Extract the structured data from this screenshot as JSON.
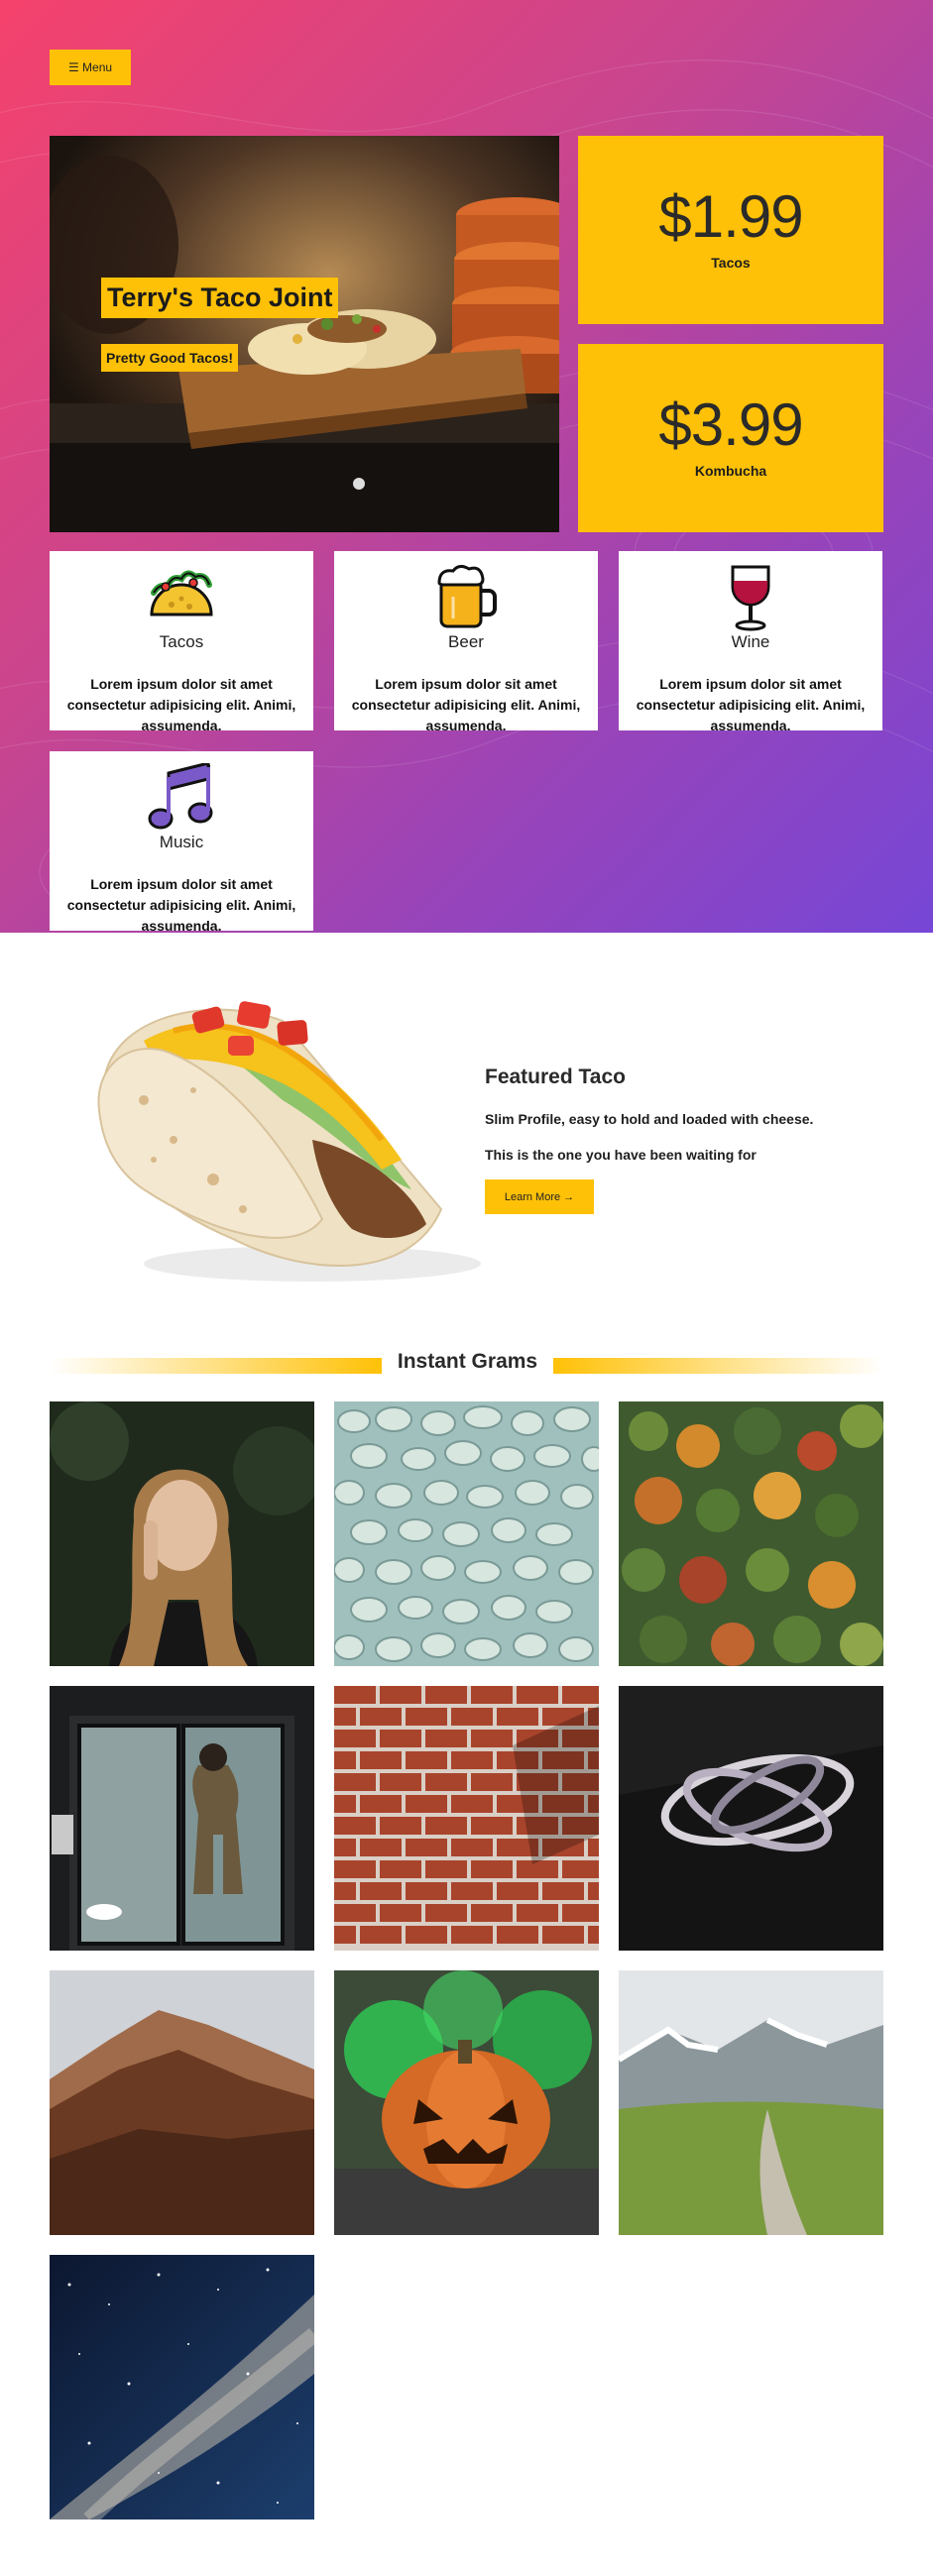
{
  "nav": {
    "menu_icon": "hamburger-icon",
    "menu_label": "☰ Menu"
  },
  "hero": {
    "title": "Terry's Taco Joint",
    "subtitle": "Pretty Good Tacos!",
    "prices": [
      {
        "amount": "$1.99",
        "name": "Tacos"
      },
      {
        "amount": "$3.99",
        "name": "Kombucha"
      }
    ],
    "colors": {
      "accent": "#ffc107",
      "gradient_start": "#f5426c",
      "gradient_end": "#7646d6"
    }
  },
  "services": [
    {
      "title": "Tacos",
      "icon": "taco-icon",
      "description": "Lorem ipsum dolor sit amet consectetur adipisicing elit. Animi, assumenda."
    },
    {
      "title": "Beer",
      "icon": "beer-mug-icon",
      "description": "Lorem ipsum dolor sit amet consectetur adipisicing elit. Animi, assumenda."
    },
    {
      "title": "Wine",
      "icon": "wine-glass-icon",
      "description": "Lorem ipsum dolor sit amet consectetur adipisicing elit. Animi, assumenda."
    },
    {
      "title": "Music",
      "icon": "music-note-icon",
      "description": "Lorem ipsum dolor sit amet consectetur adipisicing elit. Animi, assumenda."
    }
  ],
  "featured": {
    "title": "Featured Taco",
    "line1": "Slim Profile, easy to hold and loaded with cheese.",
    "line2": "This is the one you have been waiting for",
    "button": "Learn More →"
  },
  "grams": {
    "heading": "Instant Grams",
    "photos": [
      "portrait-photo",
      "pebbles-photo",
      "forest-aerial-photo",
      "doorway-photo",
      "brick-wall-photo",
      "light-rings-photo",
      "mountain-photo",
      "pumpkin-photo",
      "valley-road-photo",
      "milky-way-photo"
    ]
  }
}
